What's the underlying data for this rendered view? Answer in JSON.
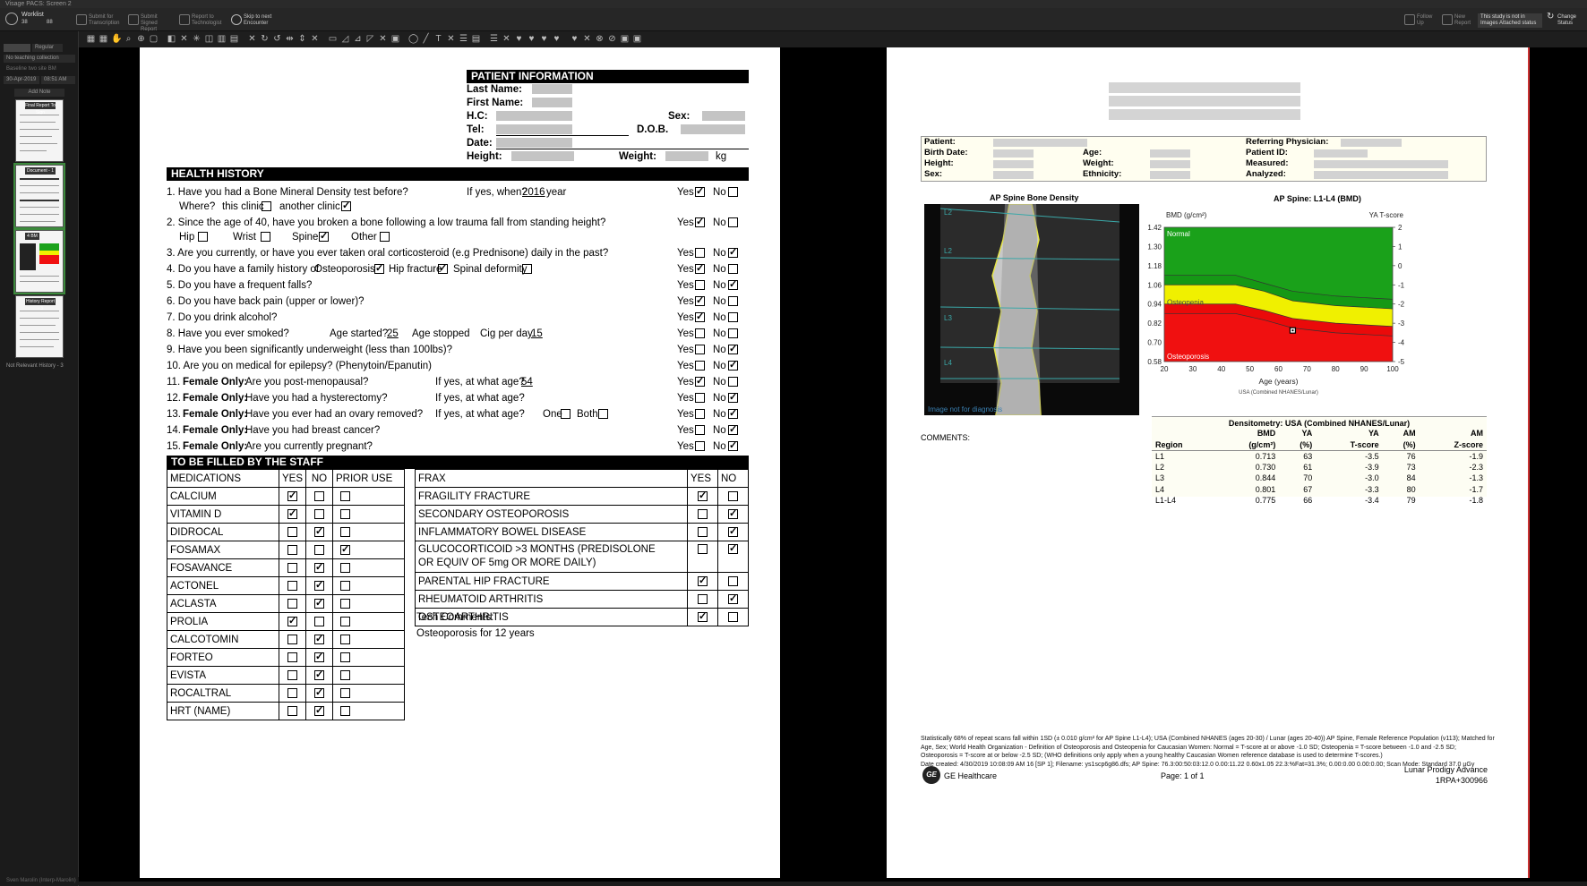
{
  "window": {
    "title": "Visage PACS: Screen 2"
  },
  "toolbar": {
    "worklist_label": "Worklist",
    "worklist_count_a": "38",
    "worklist_count_b": "88",
    "submit_transcription": "Submit for Transcription",
    "submit_signed": "Submit Signed Report",
    "report_technologist": "Report to Technologist",
    "skip_next": "Skip to next Encounter",
    "follow_up": "Follow Up",
    "new_report": "New Report",
    "study_status": "This study is not in Images Attached status",
    "change_status": "Change Status"
  },
  "sidebar": {
    "layout_value": "Regular",
    "teaching": "No teaching collection",
    "baseline": "Baseline two site BM",
    "date": "30-Apr-2019",
    "time": "08:51 AM",
    "add_note": "Add Note",
    "thumbs": [
      {
        "label": "Final Report To Sign"
      },
      {
        "label": "Document - 1"
      },
      {
        "label": "4 BM"
      },
      {
        "label": "History Report - 3"
      }
    ],
    "not_relevant": "Not Relevant History - 3",
    "footer": "Sven Marolin (Interp-Marolin)"
  },
  "left_doc": {
    "patient_info_title": "PATIENT INFORMATION",
    "last_name": "Last Name:",
    "first_name": "First Name:",
    "hc": "H.C:",
    "sex": "Sex:",
    "tel": "Tel:",
    "dob": "D.O.B.",
    "date": "Date:",
    "height": "Height:",
    "weight": "Weight:",
    "kg": "kg",
    "health_history_title": "HEALTH HISTORY",
    "q1": "1. Have you had a Bone Mineral Density test before?",
    "q1_when": "If yes, when?",
    "q1_year": "2016",
    "q1_year_suffix": "year",
    "q1_where": "Where?",
    "q1_this": "this clinic",
    "q1_another": "another clinic",
    "q2": "2. Since the age of 40, have you broken a bone following a low trauma fall from standing height?",
    "q2_hip": "Hip",
    "q2_wrist": "Wrist",
    "q2_spine": "Spine",
    "q2_other": "Other",
    "q3": "3. Are you currently, or have you ever taken oral corticosteroid (e.g Prednisone) daily in the past?",
    "q4": "4. Do you have a family history of",
    "q4_osteo": "Osteoporosis",
    "q4_hip": "Hip fracture",
    "q4_spinal": "Spinal deformity",
    "q5": "5. Do you have a frequent falls?",
    "q6": "6. Do you have back pain (upper or lower)?",
    "q7": "7. Do you drink alcohol?",
    "q8": "8. Have you ever smoked?",
    "q8_started": "Age started?",
    "q8_started_val": "25",
    "q8_stopped": "Age stopped",
    "q8_cig": "Cig per day",
    "q8_cig_val": "15",
    "q9": "9. Have you been significantly underweight (less than 100lbs)?",
    "q10": "10. Are you on medical for epilepsy? (Phenytoin/Epanutin)",
    "female_only": "Female Only:",
    "q11_num": "11.",
    "q11": "Are you post-menopausal?",
    "q11_age": "If yes, at what age?",
    "q11_age_val": "54",
    "q12_num": "12.",
    "q12": "Have you had a hysterectomy?",
    "q12_age": "If yes, at what age?",
    "q13_num": "13.",
    "q13": "Have you ever had an ovary removed?",
    "q13_age": "If yes, at what age?",
    "q13_one": "One",
    "q13_both": "Both",
    "q14_num": "14.",
    "q14": "Have you had breast cancer?",
    "q15_num": "15.",
    "q15": "Are you currently pregnant?",
    "yes": "Yes",
    "no": "No",
    "answers": [
      {
        "yes": true,
        "no": false
      },
      {
        "yes": true,
        "no": false
      },
      {
        "yes": false,
        "no": true
      },
      {
        "yes": true,
        "no": false
      },
      {
        "yes": false,
        "no": true
      },
      {
        "yes": true,
        "no": false
      },
      {
        "yes": true,
        "no": false
      },
      {
        "yes": false,
        "no": false
      },
      {
        "yes": false,
        "no": true
      },
      {
        "yes": false,
        "no": true
      },
      {
        "yes": true,
        "no": false
      },
      {
        "yes": false,
        "no": true
      },
      {
        "yes": false,
        "no": true
      },
      {
        "yes": false,
        "no": true
      },
      {
        "yes": false,
        "no": true
      }
    ],
    "staff_title": "TO BE FILLED BY THE STAFF",
    "med_headers": [
      "MEDICATIONS",
      "YES",
      "NO",
      "PRIOR USE"
    ],
    "meds": [
      {
        "name": "CALCIUM",
        "yes": true,
        "no": false,
        "prior": false
      },
      {
        "name": "VITAMIN D",
        "yes": true,
        "no": false,
        "prior": false
      },
      {
        "name": "DIDROCAL",
        "yes": false,
        "no": true,
        "prior": false
      },
      {
        "name": "FOSAMAX",
        "yes": false,
        "no": false,
        "prior": true
      },
      {
        "name": "FOSAVANCE",
        "yes": false,
        "no": true,
        "prior": false
      },
      {
        "name": "ACTONEL",
        "yes": false,
        "no": true,
        "prior": false
      },
      {
        "name": "ACLASTA",
        "yes": false,
        "no": true,
        "prior": false
      },
      {
        "name": "PROLIA",
        "yes": true,
        "no": false,
        "prior": false
      },
      {
        "name": "CALCOTOMIN",
        "yes": false,
        "no": true,
        "prior": false
      },
      {
        "name": "FORTEO",
        "yes": false,
        "no": true,
        "prior": false
      },
      {
        "name": "EVISTA",
        "yes": false,
        "no": true,
        "prior": false
      },
      {
        "name": "ROCALTRAL",
        "yes": false,
        "no": true,
        "prior": false
      },
      {
        "name": "HRT (NAME)",
        "yes": false,
        "no": true,
        "prior": false
      }
    ],
    "frax_headers": [
      "FRAX",
      "YES",
      "NO"
    ],
    "frax": [
      {
        "name": "FRAGILITY FRACTURE",
        "yes": true,
        "no": false
      },
      {
        "name": "SECONDARY OSTEOPOROSIS",
        "yes": false,
        "no": true
      },
      {
        "name": "INFLAMMATORY BOWEL DISEASE",
        "yes": false,
        "no": true
      },
      {
        "name": "GLUCOCORTICOID >3 MONTHS (PREDISOLONE",
        "name2": "OR EQUIV OF 5mg OR MORE DAILY)",
        "yes": false,
        "no": true
      },
      {
        "name": "PARENTAL HIP FRACTURE",
        "yes": true,
        "no": false
      },
      {
        "name": "RHEUMATOID ARTHRITIS",
        "yes": false,
        "no": true
      },
      {
        "name": "OSTEOARTHRITIS",
        "yes": true,
        "no": false
      }
    ],
    "tech_comments_label": "Tech Comments:",
    "tech_comments": "Osteoporosis for 12 years"
  },
  "report": {
    "patient": "Patient:",
    "birth_date": "Birth Date:",
    "height": "Height:",
    "sex": "Sex:",
    "age": "Age:",
    "weight": "Weight:",
    "ethnicity": "Ethnicity:",
    "referring": "Referring Physician:",
    "patient_id": "Patient ID:",
    "measured": "Measured:",
    "analyzed": "Analyzed:",
    "image_title": "AP Spine Bone Density",
    "image_caption": "Image not for diagnosis",
    "vert_labels": [
      "L2",
      "L2",
      "L3",
      "L4"
    ],
    "comments": "COMMENTS:",
    "dens_title": "Densitometry: USA (Combined NHANES/Lunar)",
    "dens_header1": [
      "",
      "BMD",
      "YA",
      "YA",
      "AM",
      "AM"
    ],
    "dens_header2": [
      "Region",
      "(g/cm²)",
      "(%)",
      "T-score",
      "(%)",
      "Z-score"
    ],
    "dens_rows": [
      [
        "L1",
        "0.713",
        "63",
        "-3.5",
        "76",
        "-1.9"
      ],
      [
        "L2",
        "0.730",
        "61",
        "-3.9",
        "73",
        "-2.3"
      ],
      [
        "L3",
        "0.844",
        "70",
        "-3.0",
        "84",
        "-1.3"
      ],
      [
        "L4",
        "0.801",
        "67",
        "-3.3",
        "80",
        "-1.7"
      ],
      [
        "L1-L4",
        "0.775",
        "66",
        "-3.4",
        "79",
        "-1.8"
      ]
    ],
    "fine_print": [
      "Statistically 68% of repeat scans fall within 1SD (± 0.010 g/cm² for AP Spine L1-L4); USA (Combined NHANES (ages 20-30) / Lunar (ages 20-40)) AP Spine, Female Reference Population (v113); Matched for",
      "Age, Sex; World Health Organization - Definition of Osteoporosis and Osteopenia for Caucasian Women: Normal = T-score at or above -1.0 SD; Osteopenia = T-score between -1.0 and -2.5 SD;",
      "Osteoporosis = T-score at or below -2.5 SD; (WHO definitions only apply when a young healthy Caucasian Women reference database is used to determine T-scores.)",
      "Date created: 4/30/2019 10:08:09 AM 16 [SP 1]; Filename: ys1scp6g86.dfs; AP Spine: 76.3:00:50:03:12.0 0.00:11.22 0.60x1.05 22.3:%Fat=31.3%; 0.00:0.00 0.00:0.00; Scan Mode: Standard  37.0 µGy"
    ],
    "ge_logo": "GE",
    "ge_name": "GE Healthcare",
    "page": "Page: 1 of 1",
    "device": "Lunar Prodigy Advance",
    "device_id": "1RPA+300966"
  },
  "chart_data": {
    "type": "area",
    "title": "AP Spine: L1-L4 (BMD)",
    "ylabel": "BMD (g/cm²)",
    "y2label": "YA T-score",
    "xlabel": "Age (years)",
    "subtitle": "USA (Combined NHANES/Lunar)",
    "xlim": [
      20,
      100
    ],
    "ylim": [
      0.58,
      1.42
    ],
    "x_ticks": [
      "20",
      "30",
      "40",
      "50",
      "60",
      "70",
      "80",
      "90",
      "100"
    ],
    "y_ticks": [
      "1.42",
      "1.30",
      "1.18",
      "1.06",
      "0.94",
      "0.82",
      "0.70",
      "0.58"
    ],
    "y2_ticks": [
      "2",
      "1",
      "0",
      "-1",
      "-2",
      "-3",
      "-4",
      "-5"
    ],
    "zones": [
      "Normal",
      "Osteopenia",
      "Osteoporosis"
    ],
    "zone_colors": [
      "#1aa11a",
      "#f0f000",
      "#f01010"
    ],
    "series": [
      {
        "values": [
          [
            20,
            1.06
          ],
          [
            45,
            1.06
          ],
          [
            55,
            1.02
          ],
          [
            65,
            0.96
          ],
          [
            80,
            0.93
          ],
          [
            100,
            0.91
          ]
        ]
      },
      {
        "values": [
          [
            20,
            1.12
          ],
          [
            45,
            1.12
          ],
          [
            55,
            1.07
          ],
          [
            65,
            1.02
          ],
          [
            80,
            0.99
          ],
          [
            100,
            0.97
          ]
        ]
      },
      {
        "values": [
          [
            20,
            0.94
          ],
          [
            45,
            0.94
          ],
          [
            55,
            0.9
          ],
          [
            65,
            0.85
          ],
          [
            80,
            0.82
          ],
          [
            100,
            0.8
          ]
        ]
      },
      {
        "values": [
          [
            20,
            0.88
          ],
          [
            45,
            0.88
          ],
          [
            55,
            0.84
          ],
          [
            65,
            0.79
          ],
          [
            80,
            0.76
          ],
          [
            100,
            0.74
          ]
        ]
      }
    ],
    "points": [
      {
        "x": 65,
        "y": 0.775
      }
    ]
  }
}
